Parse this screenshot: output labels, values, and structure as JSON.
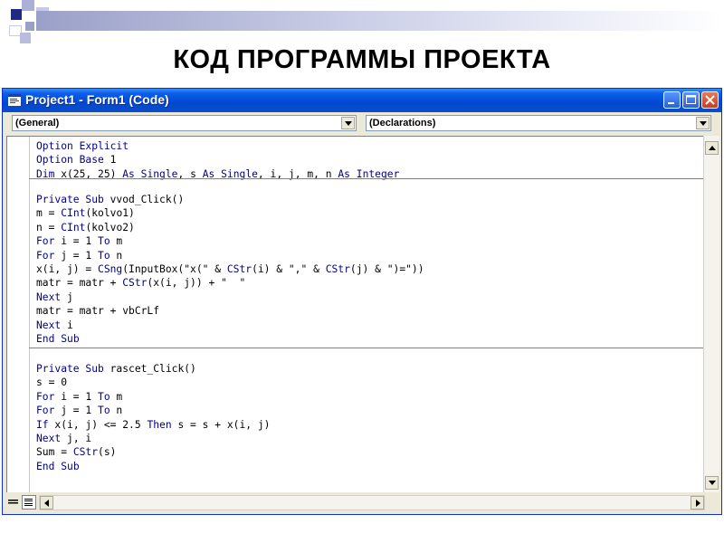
{
  "slide": {
    "title": "КОД ПРОГРАММЫ ПРОЕКТА",
    "accent_color": "#1f2a80"
  },
  "window": {
    "title": "Project1 - Form1 (Code)",
    "icon": "code-window-icon",
    "buttons": [
      "minimize-icon",
      "maximize-icon",
      "close-icon"
    ]
  },
  "combos": {
    "object_value": "(General)",
    "procedure_value": "(Declarations)"
  },
  "code": {
    "keyword_color": "#00008b",
    "declarations": [
      "Option Explicit",
      "Option Base 1",
      "Dim x(25, 25) As Single, s As Single, i, j, m, n As Integer"
    ],
    "vvod": [
      "Private Sub vvod_Click()",
      "m = CInt(kolvo1)",
      "n = CInt(kolvo2)",
      "For i = 1 To m",
      "For j = 1 To n",
      "x(i, j) = CSng(InputBox(\"x(\" & CStr(i) & \",\" & CStr(j) & \")=\"))",
      "matr = matr + CStr(x(i, j)) + \"  \"",
      "Next j",
      "matr = matr + vbCrLf",
      "Next i",
      "End Sub"
    ],
    "rascet": [
      "Private Sub rascet_Click()",
      "s = 0",
      "For i = 1 To m",
      "For j = 1 To n",
      "If x(i, j) <= 2.5 Then s = s + x(i, j)",
      "Next j, i",
      "Sum = CStr(s)",
      "End Sub"
    ]
  }
}
